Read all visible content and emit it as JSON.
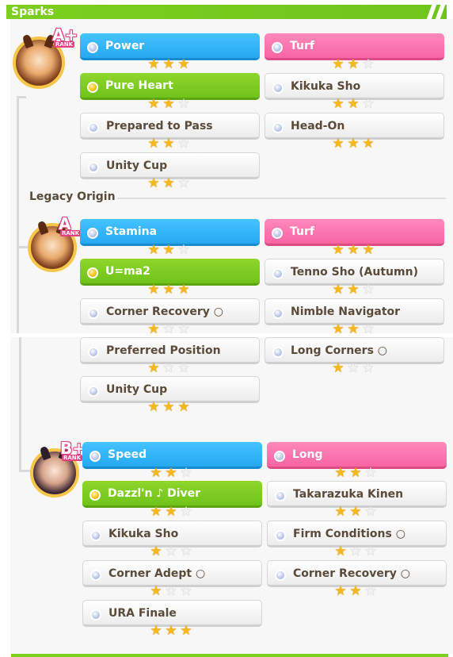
{
  "header": {
    "title": "Sparks"
  },
  "legacy_origin_label": "Legacy Origin",
  "groups": [
    {
      "rank": "A+",
      "rank_word": "RANK",
      "sparks": [
        {
          "label": "Power",
          "color": "blue",
          "stars": 3
        },
        {
          "label": "Turf",
          "color": "pink",
          "stars": 2
        },
        {
          "label": "Pure Heart",
          "color": "green",
          "stars": 2
        },
        {
          "label": "Kikuka Sho",
          "color": "white",
          "stars": 2
        },
        {
          "label": "Prepared to Pass",
          "color": "white",
          "stars": 2
        },
        {
          "label": "Head-On",
          "color": "white",
          "stars": 3
        },
        {
          "label": "Unity Cup",
          "color": "white",
          "stars": 2
        }
      ]
    },
    {
      "rank": "A",
      "rank_word": "RANK",
      "sparks": [
        {
          "label": "Stamina",
          "color": "blue",
          "stars": 2
        },
        {
          "label": "Turf",
          "color": "pink",
          "stars": 3
        },
        {
          "label": "U=ma2",
          "color": "green",
          "stars": 3
        },
        {
          "label": "Tenno Sho (Autumn)",
          "color": "white",
          "stars": 2
        },
        {
          "label": "Corner Recovery ○",
          "color": "white",
          "stars": 1
        },
        {
          "label": "Nimble Navigator",
          "color": "white",
          "stars": 2
        },
        {
          "label": "Preferred Position",
          "color": "white",
          "stars": 1
        },
        {
          "label": "Long Corners ○",
          "color": "white",
          "stars": 1
        },
        {
          "label": "Unity Cup",
          "color": "white",
          "stars": 3
        }
      ]
    },
    {
      "rank": "B+",
      "rank_word": "RANK",
      "sparks": [
        {
          "label": "Speed",
          "color": "blue",
          "stars": 2
        },
        {
          "label": "Long",
          "color": "pink",
          "stars": 2
        },
        {
          "label": "Dazzl'n ♪ Diver",
          "color": "green",
          "stars": 2
        },
        {
          "label": "Takarazuka Kinen",
          "color": "white",
          "stars": 2
        },
        {
          "label": "Kikuka Sho",
          "color": "white",
          "stars": 1
        },
        {
          "label": "Firm Conditions ○",
          "color": "white",
          "stars": 1
        },
        {
          "label": "Corner Adept ○",
          "color": "white",
          "stars": 1
        },
        {
          "label": "Corner Recovery ○",
          "color": "white",
          "stars": 2
        },
        {
          "label": "URA Finale",
          "color": "white",
          "stars": 3
        }
      ]
    }
  ]
}
